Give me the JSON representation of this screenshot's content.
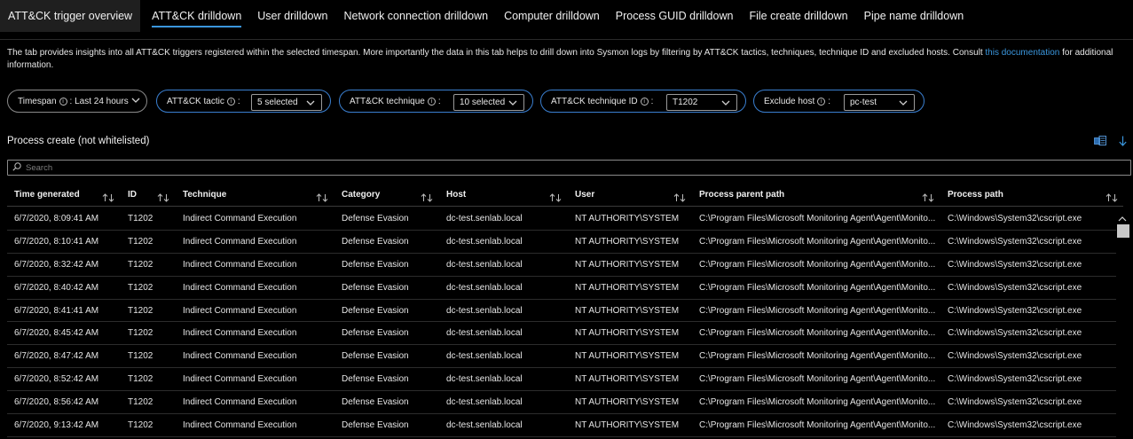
{
  "tabs": [
    {
      "label": "ATT&CK trigger overview"
    },
    {
      "label": "ATT&CK drilldown"
    },
    {
      "label": "User drilldown"
    },
    {
      "label": "Network connection drilldown"
    },
    {
      "label": "Computer drilldown"
    },
    {
      "label": "Process GUID drilldown"
    },
    {
      "label": "File create drilldown"
    },
    {
      "label": "Pipe name drilldown"
    }
  ],
  "description": {
    "text": "The tab provides insights into all ATT&CK triggers registered within the selected timespan. More importantly the data in this tab helps to drill down into Sysmon logs by filtering by ATT&CK tactics, techniques, technique ID and excluded hosts. Consult ",
    "link": "this documentation",
    "after": " for additional information."
  },
  "filters": {
    "timespan": {
      "label": "Timespan",
      "value": ": Last 24 hours"
    },
    "tactic": {
      "label": "ATT&CK tactic",
      "value": "5 selected"
    },
    "technique": {
      "label": "ATT&CK technique",
      "value": "10 selected"
    },
    "technique_id": {
      "label": "ATT&CK technique ID",
      "value": "T1202"
    },
    "exclude_host": {
      "label": "Exclude host",
      "value": "pc-test"
    }
  },
  "section": {
    "title": "Process create (not whitelisted)"
  },
  "search": {
    "placeholder": "Search"
  },
  "table": {
    "columns": [
      "Time generated",
      "ID",
      "Technique",
      "Category",
      "Host",
      "User",
      "Process parent path",
      "Process path"
    ],
    "rows": [
      [
        "6/7/2020, 8:09:41 AM",
        "T1202",
        "Indirect Command Execution",
        "Defense Evasion",
        "dc-test.senlab.local",
        "NT AUTHORITY\\SYSTEM",
        "C:\\Program Files\\Microsoft Monitoring Agent\\Agent\\Monito...",
        "C:\\Windows\\System32\\cscript.exe"
      ],
      [
        "6/7/2020, 8:10:41 AM",
        "T1202",
        "Indirect Command Execution",
        "Defense Evasion",
        "dc-test.senlab.local",
        "NT AUTHORITY\\SYSTEM",
        "C:\\Program Files\\Microsoft Monitoring Agent\\Agent\\Monito...",
        "C:\\Windows\\System32\\cscript.exe"
      ],
      [
        "6/7/2020, 8:32:42 AM",
        "T1202",
        "Indirect Command Execution",
        "Defense Evasion",
        "dc-test.senlab.local",
        "NT AUTHORITY\\SYSTEM",
        "C:\\Program Files\\Microsoft Monitoring Agent\\Agent\\Monito...",
        "C:\\Windows\\System32\\cscript.exe"
      ],
      [
        "6/7/2020, 8:40:42 AM",
        "T1202",
        "Indirect Command Execution",
        "Defense Evasion",
        "dc-test.senlab.local",
        "NT AUTHORITY\\SYSTEM",
        "C:\\Program Files\\Microsoft Monitoring Agent\\Agent\\Monito...",
        "C:\\Windows\\System32\\cscript.exe"
      ],
      [
        "6/7/2020, 8:41:41 AM",
        "T1202",
        "Indirect Command Execution",
        "Defense Evasion",
        "dc-test.senlab.local",
        "NT AUTHORITY\\SYSTEM",
        "C:\\Program Files\\Microsoft Monitoring Agent\\Agent\\Monito...",
        "C:\\Windows\\System32\\cscript.exe"
      ],
      [
        "6/7/2020, 8:45:42 AM",
        "T1202",
        "Indirect Command Execution",
        "Defense Evasion",
        "dc-test.senlab.local",
        "NT AUTHORITY\\SYSTEM",
        "C:\\Program Files\\Microsoft Monitoring Agent\\Agent\\Monito...",
        "C:\\Windows\\System32\\cscript.exe"
      ],
      [
        "6/7/2020, 8:47:42 AM",
        "T1202",
        "Indirect Command Execution",
        "Defense Evasion",
        "dc-test.senlab.local",
        "NT AUTHORITY\\SYSTEM",
        "C:\\Program Files\\Microsoft Monitoring Agent\\Agent\\Monito...",
        "C:\\Windows\\System32\\cscript.exe"
      ],
      [
        "6/7/2020, 8:52:42 AM",
        "T1202",
        "Indirect Command Execution",
        "Defense Evasion",
        "dc-test.senlab.local",
        "NT AUTHORITY\\SYSTEM",
        "C:\\Program Files\\Microsoft Monitoring Agent\\Agent\\Monito...",
        "C:\\Windows\\System32\\cscript.exe"
      ],
      [
        "6/7/2020, 8:56:42 AM",
        "T1202",
        "Indirect Command Execution",
        "Defense Evasion",
        "dc-test.senlab.local",
        "NT AUTHORITY\\SYSTEM",
        "C:\\Program Files\\Microsoft Monitoring Agent\\Agent\\Monito...",
        "C:\\Windows\\System32\\cscript.exe"
      ],
      [
        "6/7/2020, 9:13:42 AM",
        "T1202",
        "Indirect Command Execution",
        "Defense Evasion",
        "dc-test.senlab.local",
        "NT AUTHORITY\\SYSTEM",
        "C:\\Program Files\\Microsoft Monitoring Agent\\Agent\\Monito...",
        "C:\\Windows\\System32\\cscript.exe"
      ]
    ]
  },
  "colors": {
    "background": "#000000",
    "accent": "#3a96dd",
    "pill_border_active": "#3a7fd0",
    "text": "#e6e6e6"
  },
  "icons": {
    "sort": "sort-arrows-icon",
    "export": "export-excel-icon",
    "download": "down-arrow-icon",
    "search": "search-icon",
    "chevron": "chevron-down-icon",
    "info": "info-icon"
  }
}
